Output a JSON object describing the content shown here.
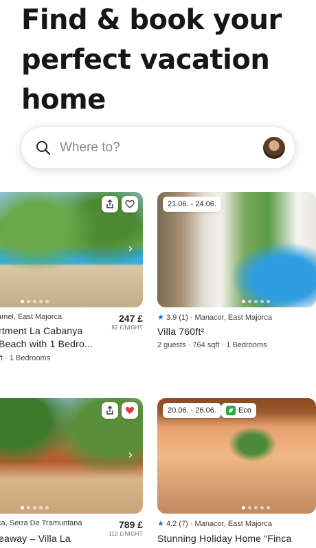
{
  "hero": {
    "title": "Find & book your perfect vacation home"
  },
  "search": {
    "placeholder": "Where to?"
  },
  "cards": [
    {
      "location": "amel, East Majorca",
      "title_line1": "rtment La Cabanya",
      "title_line2": "Beach with 1 Bedro...",
      "details": "ft · 1 Bedrooms",
      "price": "247 £",
      "price_unit": "82 £/NIGHT",
      "favorited": false
    },
    {
      "dates": "21.06. - 24.06.",
      "rating": "3.9",
      "reviews": "(1)",
      "location": "· Manacor, East Majorca",
      "title_line1": "Villa 760ft²",
      "details": "2 guests · 764 sqft · 1 Bedrooms",
      "favorited": false
    },
    {
      "location": "ça, Serra De Tramuntana",
      "title_line1": "eaway  – Villa La",
      "price": "789 £",
      "price_unit": "112 £/NIGHT",
      "favorited": true
    },
    {
      "dates": "20.06. - 26.06.",
      "eco": "Eco",
      "rating": "4.2",
      "reviews": "(7)",
      "location": "· Manacor, East Majorca",
      "title_line1": "Stunning Holiday Home “Finca",
      "favorited": false
    }
  ],
  "colors": {
    "accent_heart": "#e0394a",
    "star": "#1a6dd6",
    "eco": "#2da84a"
  }
}
